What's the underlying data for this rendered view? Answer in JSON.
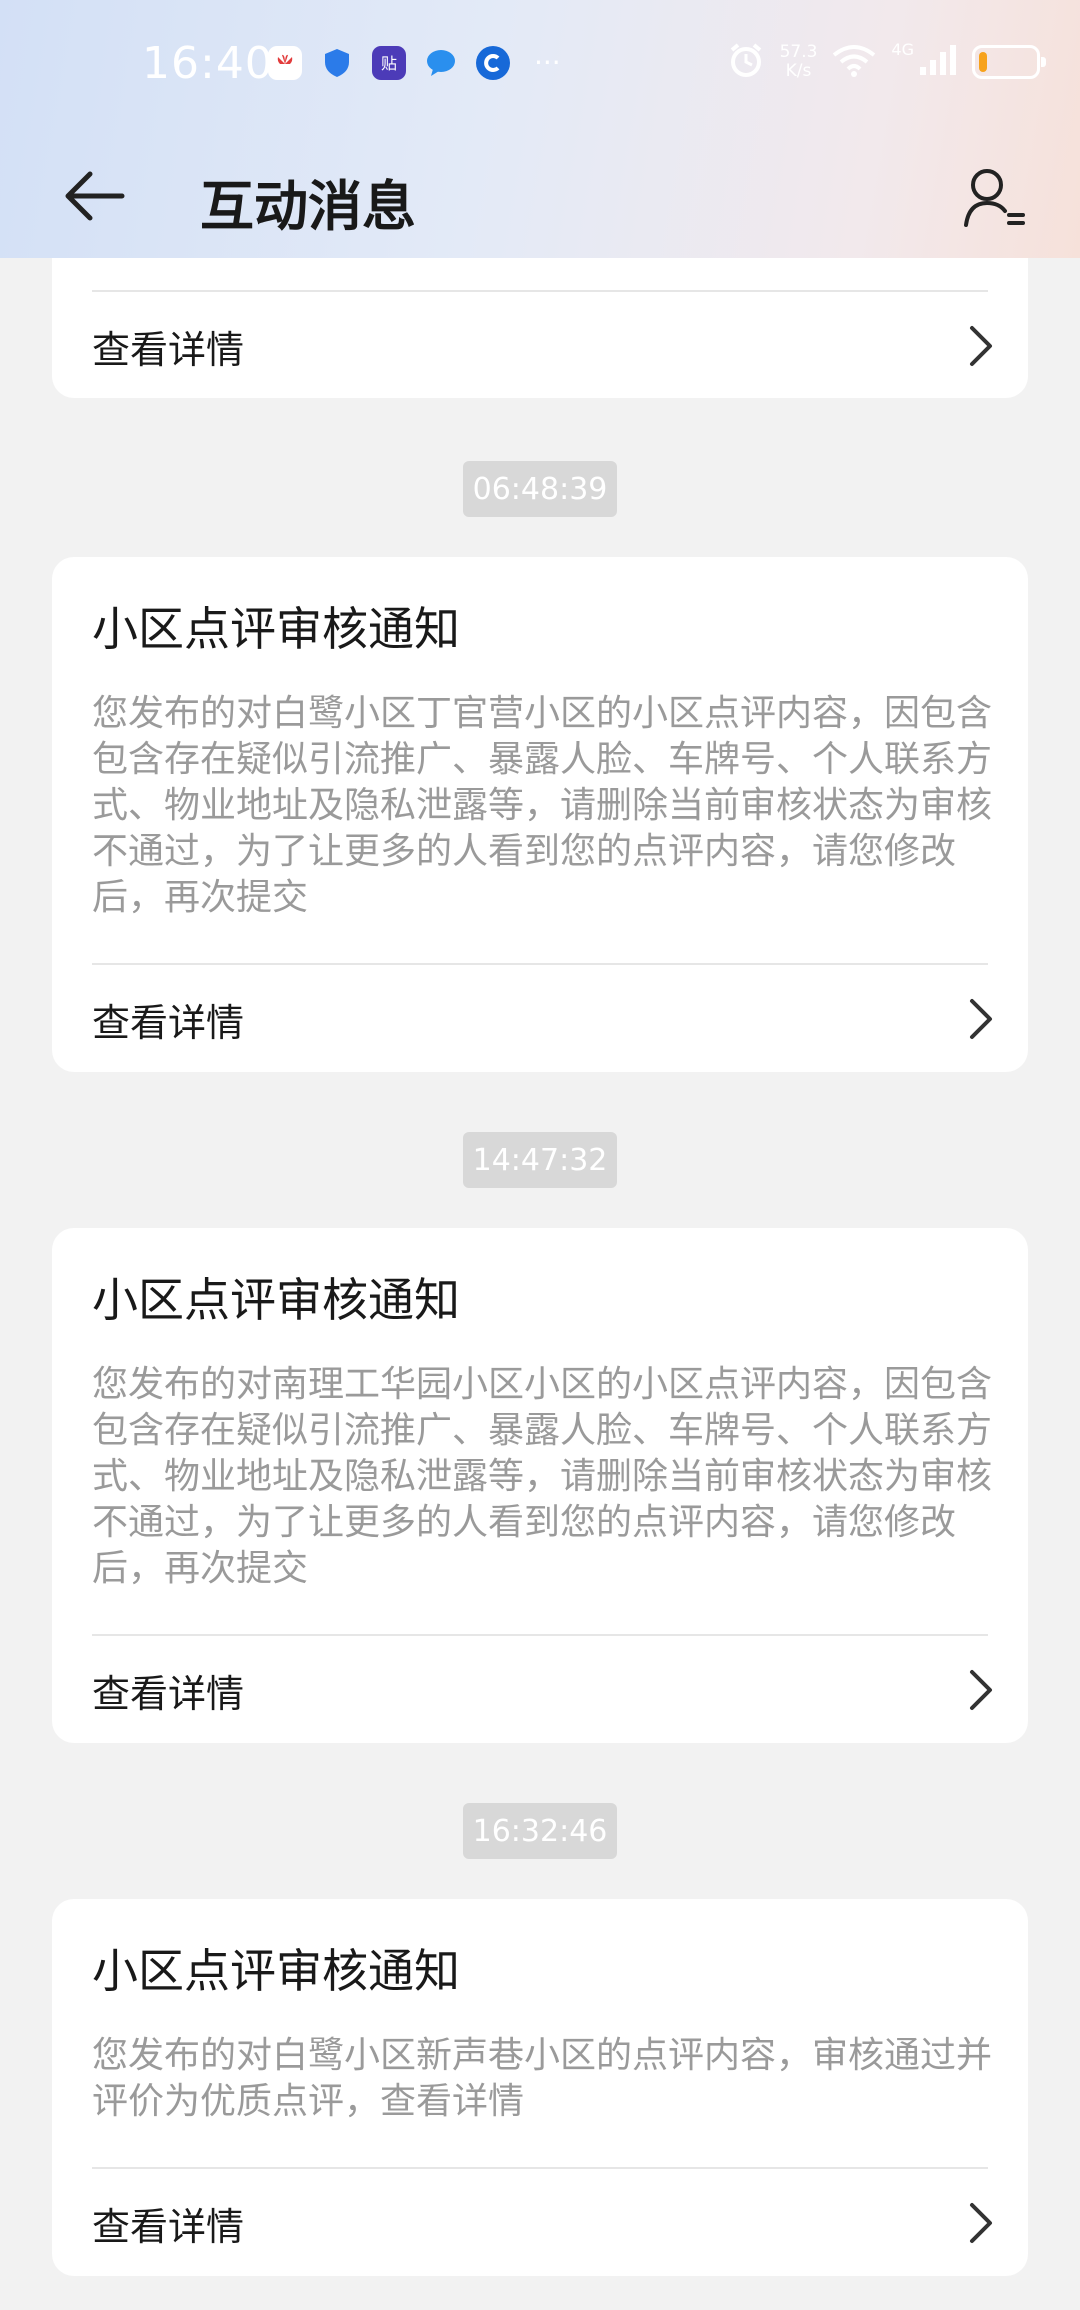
{
  "status_bar": {
    "time": "16:40",
    "notification_icons": [
      "huawei-app-icon",
      "shield-app-icon",
      "tieba-app-icon",
      "chat-bubble-app-icon",
      "browser-app-icon"
    ],
    "notification_more": "···",
    "net_speed_value": "57.3",
    "net_speed_unit": "K/s",
    "network_type": "4G",
    "battery_level": 0.15,
    "battery_color": "#f7a21b"
  },
  "header": {
    "title": "互动消息"
  },
  "messages": [
    {
      "time": "",
      "title": "",
      "body": "",
      "detail_label": "查看详情"
    },
    {
      "time": "06:48:39",
      "title": "小区点评审核通知",
      "body": "您发布的对白鹭小区丁官营小区的小区点评内容，因包含包含存在疑似引流推广、暴露人脸、车牌号、个人联系方式、物业地址及隐私泄露等，请删除当前审核状态为审核不通过，为了让更多的人看到您的点评内容，请您修改后，再次提交",
      "detail_label": "查看详情"
    },
    {
      "time": "14:47:32",
      "title": "小区点评审核通知",
      "body": "您发布的对南理工华园小区小区的小区点评内容，因包含包含存在疑似引流推广、暴露人脸、车牌号、个人联系方式、物业地址及隐私泄露等，请删除当前审核状态为审核不通过，为了让更多的人看到您的点评内容，请您修改后，再次提交",
      "detail_label": "查看详情"
    },
    {
      "time": "16:32:46",
      "title": "小区点评审核通知",
      "body": "您发布的对白鹭小区新声巷小区的点评内容，审核通过并评价为优质点评，查看详情",
      "detail_label": "查看详情"
    }
  ]
}
